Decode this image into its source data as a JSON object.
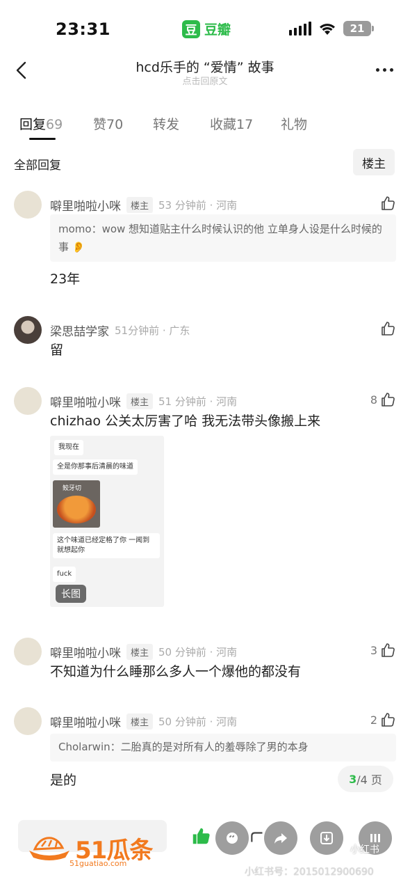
{
  "status_bar": {
    "time": "23:31",
    "app_logo_char": "豆",
    "app_name": "豆瓣",
    "battery": "21"
  },
  "header": {
    "title": "hcd乐手的 “爱情” 故事",
    "subtitle": "点击回原文"
  },
  "tabs": [
    {
      "label": "回复",
      "count": "69"
    },
    {
      "label": "赞",
      "count": "70"
    },
    {
      "label": "转发",
      "count": ""
    },
    {
      "label": "收藏",
      "count": "17"
    },
    {
      "label": "礼物",
      "count": ""
    }
  ],
  "section": {
    "title": "全部回复",
    "filter": "楼主"
  },
  "comments": [
    {
      "name": "噼里啪啦小咪",
      "tag": "楼主",
      "meta": "53 分钟前 · 河南",
      "likes": "",
      "quote": "momo：wow 想知道贴主什么时候认识的他 立单身人设是什么时候的事 👂",
      "text": "23年"
    },
    {
      "name": "梁思喆学家",
      "tag": "",
      "meta": "51分钟前 · 广东",
      "likes": "",
      "text": "留"
    },
    {
      "name": "噼里啪啦小咪",
      "tag": "楼主",
      "meta": "51 分钟前 · 河南",
      "likes": "8",
      "text": "chizhao 公关太厉害了哈 我无法带头像搬上来",
      "image": {
        "bubbles": [
          "我现在",
          "全是你那事后清晨的味道",
          "这个味道已经定格了你 一闻到就想起你",
          "fuck"
        ],
        "pumpkin_caption": "鲛牙切",
        "label": "长图"
      }
    },
    {
      "name": "噼里啪啦小咪",
      "tag": "楼主",
      "meta": "50 分钟前 · 河南",
      "likes": "3",
      "text": "不知道为什么睡那么多人一个爆他的都没有"
    },
    {
      "name": "噼里啪啦小咪",
      "tag": "楼主",
      "meta": "50 分钟前 · 河南",
      "likes": "2",
      "quote": "Cholarwin：二胎真的是对所有人的羞辱除了男的本身",
      "text": "是的"
    }
  ],
  "pager": {
    "current": "3",
    "total": "/4 页"
  },
  "watermark": {
    "brand": "51瓜条",
    "url": "51guatiao.com",
    "xhs_mark": "小红书",
    "xhs_id": "小红书号：2015012900690"
  },
  "colors": {
    "accent": "#2dbb4a",
    "watermark": "#f27a1f"
  }
}
